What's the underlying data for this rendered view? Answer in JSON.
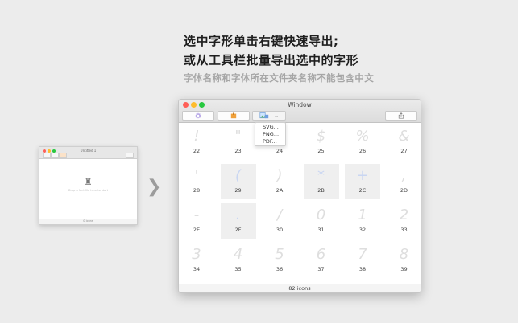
{
  "headline": {
    "line1": "选中字形单击右键快速导出;",
    "line2": "或从工具栏批量导出选中的字形",
    "subtitle": "字体名称和字体所在文件夹名称不能包含中文"
  },
  "thumbnail": {
    "title": "Untitled 1",
    "drop_hint": "Drop a font file here to start",
    "status": "0 icons"
  },
  "window": {
    "title": "Window",
    "toolbar": {
      "settings_icon": "gear-icon",
      "package_icon": "box-icon",
      "export_icon": "export-image-icon",
      "share_icon": "share-icon",
      "dropdown_glyph": "⌄"
    },
    "export_menu": [
      "SVG...",
      "PNG...",
      "PDF..."
    ],
    "glyphs": [
      {
        "char": "!",
        "code": "22",
        "selected": false
      },
      {
        "char": "\"",
        "code": "23",
        "selected": false
      },
      {
        "char": "#",
        "code": "24",
        "selected": false
      },
      {
        "char": "$",
        "code": "25",
        "selected": false
      },
      {
        "char": "%",
        "code": "26",
        "selected": false
      },
      {
        "char": "&",
        "code": "27",
        "selected": false
      },
      {
        "char": "'",
        "code": "28",
        "selected": false
      },
      {
        "char": "(",
        "code": "29",
        "selected": true
      },
      {
        "char": ")",
        "code": "2A",
        "selected": false
      },
      {
        "char": "*",
        "code": "2B",
        "selected": true
      },
      {
        "char": "+",
        "code": "2C",
        "selected": true
      },
      {
        "char": ",",
        "code": "2D",
        "selected": false
      },
      {
        "char": "-",
        "code": "2E",
        "selected": false
      },
      {
        "char": ".",
        "code": "2F",
        "selected": true
      },
      {
        "char": "/",
        "code": "30",
        "selected": false
      },
      {
        "char": "0",
        "code": "31",
        "selected": false
      },
      {
        "char": "1",
        "code": "32",
        "selected": false
      },
      {
        "char": "2",
        "code": "33",
        "selected": false
      },
      {
        "char": "3",
        "code": "34",
        "selected": false
      },
      {
        "char": "4",
        "code": "35",
        "selected": false
      },
      {
        "char": "5",
        "code": "36",
        "selected": false
      },
      {
        "char": "6",
        "code": "37",
        "selected": false
      },
      {
        "char": "7",
        "code": "38",
        "selected": false
      },
      {
        "char": "8",
        "code": "39",
        "selected": false
      }
    ],
    "status": "82 icons"
  },
  "colors": {
    "close": "#ff5f57",
    "minimize": "#febc2e",
    "zoom": "#28c840",
    "selection_bg": "#efefef",
    "selected_glyph": "#c9d6f2"
  }
}
